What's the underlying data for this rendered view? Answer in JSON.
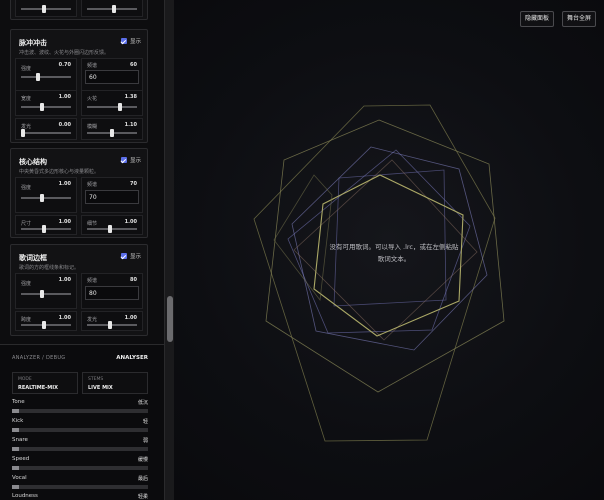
{
  "panel": {
    "top_sliders": {
      "left_value": "",
      "right_value": ""
    },
    "pulse": {
      "title": "脉冲冲击",
      "subtitle": "冲击波、波纹、火花与外圈闪边形反馈。",
      "show_label": "显示",
      "controls": [
        {
          "label": "强度",
          "value": "0.70",
          "type": "slider",
          "level": 0.35
        },
        {
          "label": "频谱",
          "value": "60",
          "type": "number",
          "input": "60"
        },
        {
          "label": "宽度",
          "value": "1.00",
          "type": "slider",
          "level": 0.5
        },
        {
          "label": "火花",
          "value": "1.38",
          "type": "slider",
          "level": 0.69
        },
        {
          "label": "发光",
          "value": "0.00",
          "type": "slider",
          "level": 0.0
        },
        {
          "label": "模糊",
          "value": "1.10",
          "type": "slider",
          "level": 0.55
        }
      ]
    },
    "core": {
      "title": "核心结构",
      "subtitle": "中央黄昏式多边形核心与液量颗粒。",
      "show_label": "显示",
      "controls": [
        {
          "label": "强度",
          "value": "1.00",
          "type": "slider",
          "level": 0.5
        },
        {
          "label": "频谱",
          "value": "70",
          "type": "number",
          "input": "70"
        },
        {
          "label": "尺寸",
          "value": "1.00",
          "type": "slider",
          "level": 0.5
        },
        {
          "label": "细节",
          "value": "1.00",
          "type": "slider",
          "level": 0.5
        }
      ]
    },
    "lyric": {
      "title": "歌词边框",
      "subtitle": "歌词的方的框线条和标记。",
      "show_label": "显示",
      "controls": [
        {
          "label": "强度",
          "value": "1.00",
          "type": "slider",
          "level": 0.5
        },
        {
          "label": "频谱",
          "value": "80",
          "type": "number",
          "input": "80"
        },
        {
          "label": "跨度",
          "value": "1.00",
          "type": "slider",
          "level": 0.5
        },
        {
          "label": "发光",
          "value": "1.00",
          "type": "slider",
          "level": 0.5
        }
      ]
    }
  },
  "analyzer": {
    "title": "ANALYZER / DEBUG",
    "tag": "ANALYSER",
    "mode": {
      "key": "MODE",
      "value": "REALTIME-MIX"
    },
    "stems": {
      "key": "STEMS",
      "value": "LIVE MIX"
    },
    "meters": [
      {
        "label": "Tone",
        "value": "低沉",
        "level": 0.05
      },
      {
        "label": "Kick",
        "value": "轻",
        "level": 0.05
      },
      {
        "label": "Snare",
        "value": "弱",
        "level": 0.05
      },
      {
        "label": "Speed",
        "value": "缓慢",
        "level": 0.05
      },
      {
        "label": "Vocal",
        "value": "最后",
        "level": 0.05
      },
      {
        "label": "Loudness",
        "value": "轻柔",
        "level": 0.05
      }
    ]
  },
  "stage": {
    "hide_panel_label": "隐藏面板",
    "fullscreen_label": "舞台全屏",
    "empty_lyric_line1": "没有可用歌词。可以导入 .lrc，或在左侧粘贴",
    "empty_lyric_line2": "歌词文本。"
  },
  "colors": {
    "accent": "#5b6ee8",
    "polygon_gold": "#a5a46c",
    "polygon_violet": "#8a8ad6"
  }
}
